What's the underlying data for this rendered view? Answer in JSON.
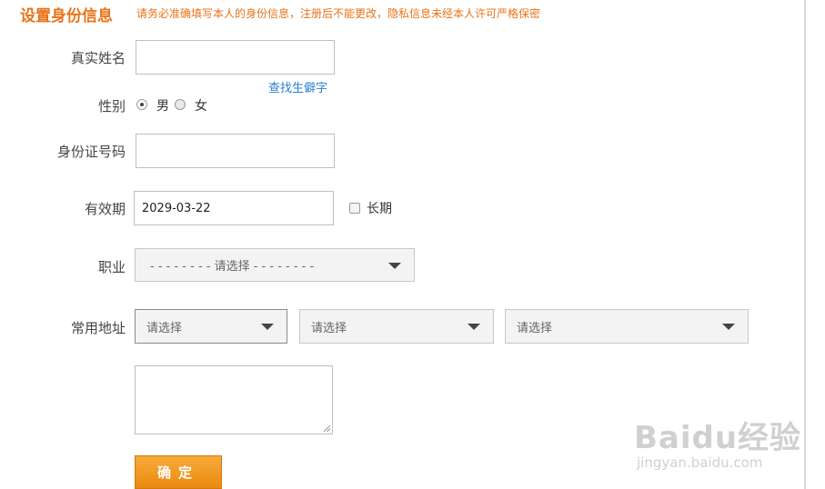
{
  "header": {
    "title": "设置身份信息",
    "note": "请务必准确填写本人的身份信息，注册后不能更改，隐私信息未经本人许可严格保密"
  },
  "form": {
    "real_name": {
      "label": "真实姓名",
      "value": ""
    },
    "rare_char_link": "查找生僻字",
    "gender": {
      "label": "性别",
      "options": [
        "男",
        "女"
      ],
      "selected": "男"
    },
    "id_number": {
      "label": "身份证号码",
      "value": ""
    },
    "validity": {
      "label": "有效期",
      "value": "2029-03-22",
      "long_term_label": "长期",
      "long_term_checked": false
    },
    "occupation": {
      "label": "职业",
      "value": "- - - - - - - - 请选择 - - - - - - - -"
    },
    "address": {
      "label": "常用地址",
      "province": "请选择",
      "city": "请选择",
      "district": "请选择",
      "detail": ""
    },
    "submit_label": "确定"
  },
  "watermark": {
    "brand": "Baidu经验",
    "url": "jingyan.baidu.com"
  },
  "colors": {
    "accent": "#e8731a",
    "link": "#2a7ed6",
    "button": "#ea8a10"
  }
}
